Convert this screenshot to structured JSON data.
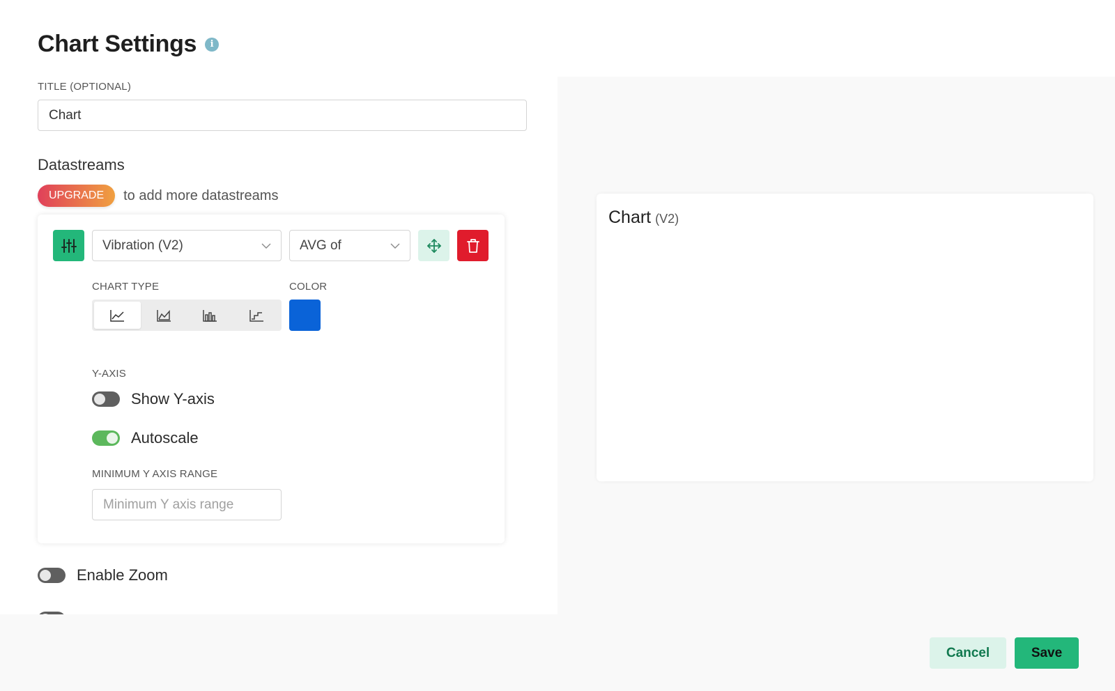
{
  "header": {
    "title": "Chart Settings",
    "info_icon": "i"
  },
  "title_field": {
    "label": "TITLE (OPTIONAL)",
    "value": "Chart"
  },
  "datastreams": {
    "heading": "Datastreams",
    "upgrade_badge": "UPGRADE",
    "upgrade_text": "to add more datastreams",
    "item": {
      "datastream_select": "Vibration (V2)",
      "aggregation_select": "AVG of",
      "chart_type_label": "CHART TYPE",
      "chart_types": [
        "line",
        "area",
        "bar",
        "step"
      ],
      "selected_chart_type": "line",
      "color_label": "COLOR",
      "color": "#0a63d8",
      "y_axis_label": "Y-AXIS",
      "show_y_axis": {
        "label": "Show Y-axis",
        "on": false
      },
      "autoscale": {
        "label": "Autoscale",
        "on": true
      },
      "min_range_label": "MINIMUM Y AXIS RANGE",
      "min_range_placeholder": "Minimum Y axis range"
    }
  },
  "enable_zoom": {
    "label": "Enable Zoom",
    "on": false
  },
  "preview": {
    "title": "Chart",
    "subtitle": "(V2)"
  },
  "footer": {
    "cancel": "Cancel",
    "save": "Save"
  },
  "colors": {
    "accent": "#23b77a",
    "danger": "#e01c2c",
    "series": "#0a63d8"
  }
}
